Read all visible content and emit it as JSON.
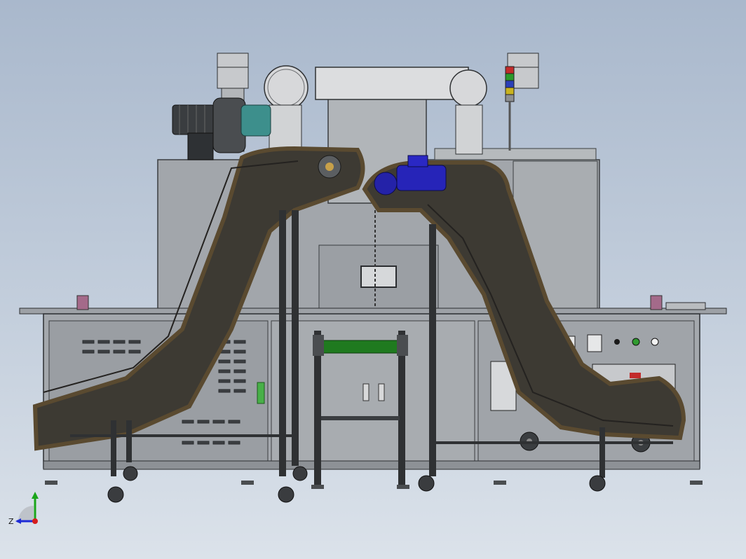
{
  "triad": {
    "z_label": "Z",
    "y_color": "#1aa51a",
    "z_color": "#1d2bd6",
    "x_color": "#d61d1d"
  },
  "colors": {
    "frame_gray": "#8a8f95",
    "panel_gray": "#a7abb0",
    "conveyor_brown": "#4d4536",
    "duct_white": "#d9dadb",
    "motor_blue": "#2422b8",
    "motor_teal": "#3b8c8c",
    "roller_green": "#1f7a1f"
  },
  "model": {
    "name": "conveyor-machine-assembly"
  }
}
